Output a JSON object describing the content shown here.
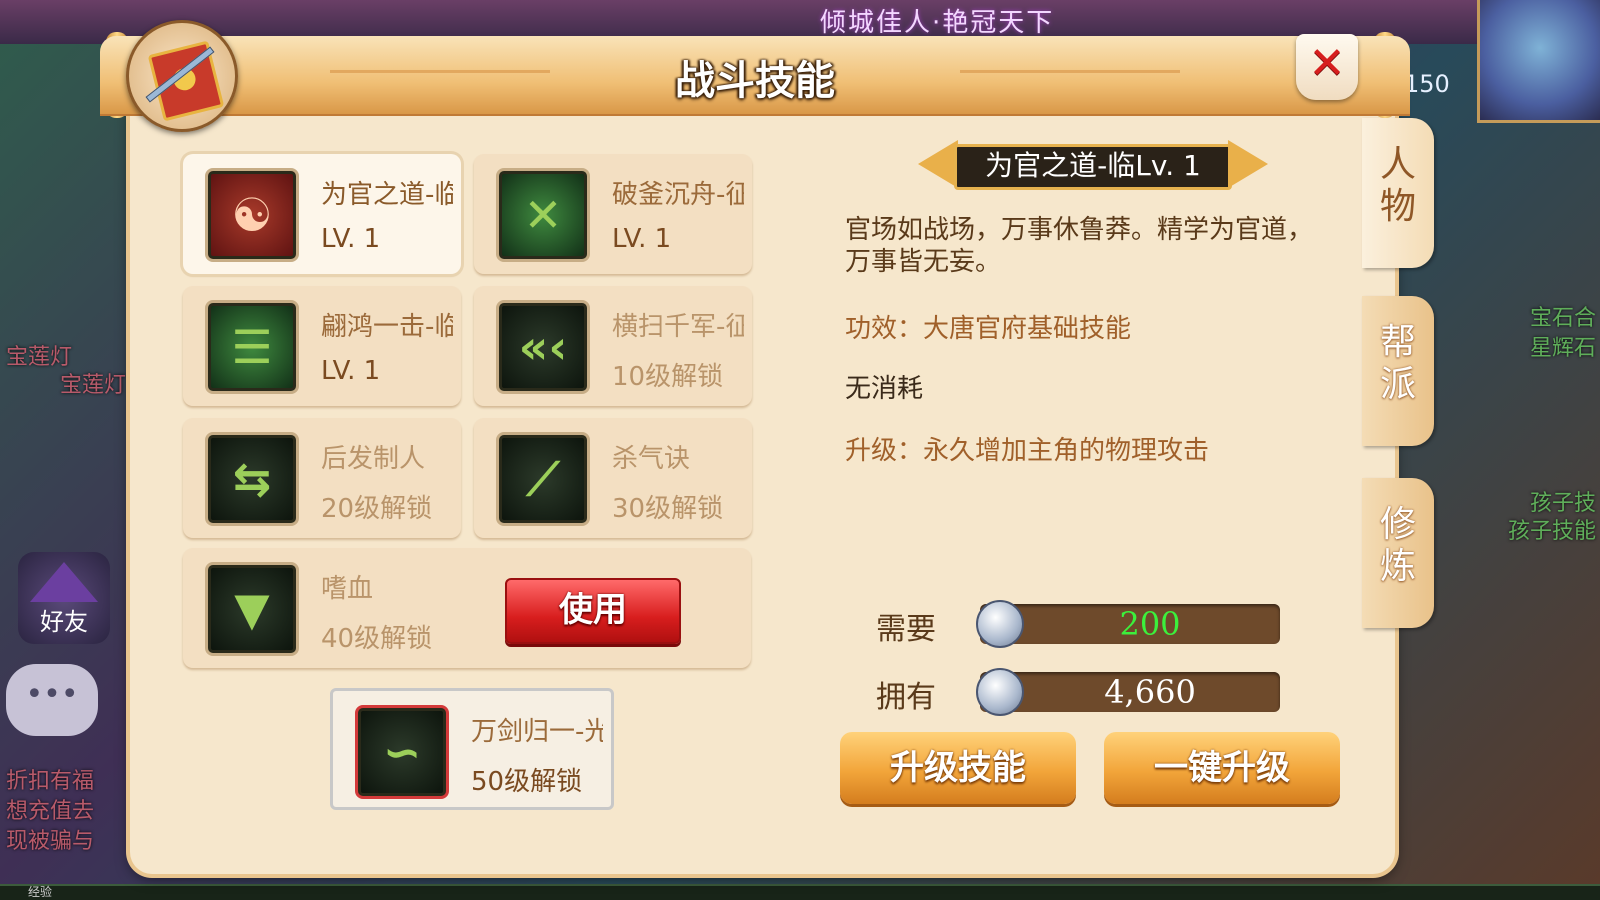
{
  "background": {
    "banner_text": "倾城佳人·艳冠天下",
    "level_text": "150",
    "right_texts": [
      "宝石合",
      "星辉石",
      "孩子技",
      "孩子技能"
    ],
    "left_texts": [
      "宝莲灯",
      "宝莲灯"
    ],
    "friend_label": "好友",
    "promo_lines": [
      "折扣有福",
      "想充值去",
      "现被骗与"
    ],
    "xp_label": "经验"
  },
  "window": {
    "title": "战斗技能",
    "close_label": "✕"
  },
  "side_tabs": [
    {
      "label": "人物",
      "active": true
    },
    {
      "label": "帮派",
      "active": false
    },
    {
      "label": "修炼",
      "active": false
    }
  ],
  "skills": [
    {
      "name": "为官之道-临",
      "level": "LV. 1",
      "icon": "face-rune-icon"
    },
    {
      "name": "破釜沉舟-征",
      "level": "LV. 1",
      "icon": "crossed-blades-icon"
    },
    {
      "name": "翩鸿一击-临",
      "level": "LV. 1",
      "icon": "scroll-rune-icon"
    },
    {
      "name": "横扫千军-征",
      "level": "10级解锁",
      "icon": "triple-chevron-icon"
    },
    {
      "name": "后发制人",
      "level": "20级解锁",
      "icon": "reverse-arrows-icon"
    },
    {
      "name": "杀气诀",
      "level": "30级解锁",
      "icon": "sword-dash-icon"
    },
    {
      "name": "嗜血",
      "level": "40级解锁",
      "icon": "fanged-mouth-icon"
    },
    {
      "name": "万剑归一-光",
      "level": "50级解锁",
      "icon": "dragon-sword-icon"
    }
  ],
  "use_button": "使用",
  "detail": {
    "title": "为官之道-临Lv. 1",
    "description": "官场如战场，万事休鲁莽。精学为官道，万事皆无妄。",
    "effect": "功效：大唐官府基础技能",
    "cost": "无消耗",
    "upgrade": "升级：永久增加主角的物理攻击"
  },
  "resources": {
    "need_label": "需要",
    "need_value": "200",
    "have_label": "拥有",
    "have_value": "4,660"
  },
  "buttons": {
    "upgrade": "升级技能",
    "upgrade_all": "一键升级"
  }
}
